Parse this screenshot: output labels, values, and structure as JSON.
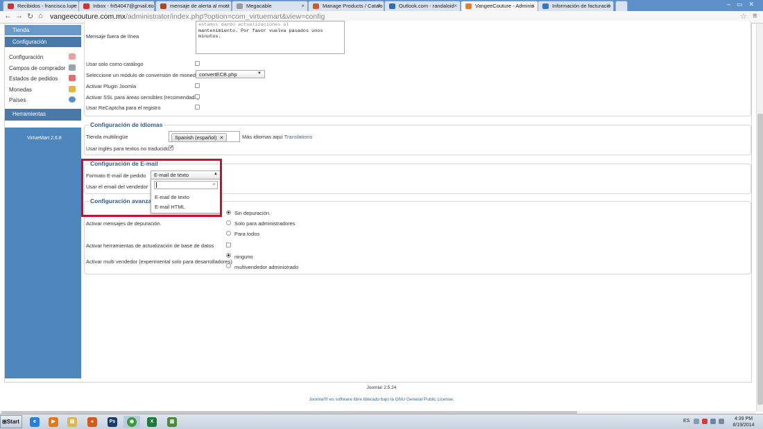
{
  "browser": {
    "tabs": [
      {
        "label": "Recibidos - francisco.lupe",
        "color": "#c33"
      },
      {
        "label": "Inbox - fri54047@gmail.co",
        "color": "#c33"
      },
      {
        "label": "mensaje de alerta al most",
        "color": "#b5431a"
      },
      {
        "label": "Megacable",
        "color": "#999"
      },
      {
        "label": "Manage Products / Catalo",
        "color": "#d05a2a"
      },
      {
        "label": "Outlook.com - randaloid",
        "color": "#2a6fb8"
      },
      {
        "label": "VangeeCouture - Adminis",
        "color": "#e0822a"
      },
      {
        "label": "Información de facturació",
        "color": "#3a75c4"
      }
    ],
    "url_host": "vangeecouture.com.mx",
    "url_path": "/administrator/index.php?option=com_virtuemart&view=config"
  },
  "sidebar": {
    "tienda": "Tienda",
    "configuracion_header": "Configuración",
    "items": [
      {
        "label": "Configuración",
        "icon": "wrench-icon",
        "color": "#e8a0a0"
      },
      {
        "label": "Campos de comprador",
        "icon": "fields-icon",
        "color": "#9aa4b0"
      },
      {
        "label": "Estados de pedidos",
        "icon": "order-status-icon",
        "color": "#e07070"
      },
      {
        "label": "Monedas",
        "icon": "coins-icon",
        "color": "#e6b24a"
      },
      {
        "label": "Países",
        "icon": "globe-icon",
        "color": "#5a8fc8"
      }
    ],
    "herramientas": "Herramientas",
    "version": "VirtueMart 2.6.8"
  },
  "general": {
    "mensaje_label": "Mensaje fuera de línea",
    "mensaje_text_lines": [
      "estamos dando actualizaciones al",
      "mantenimiento. Por favor vuelva pasados unos",
      "minutos."
    ],
    "catalog_label": "Usar solo como catálogo",
    "currency_label": "Seleccione un módulo de conversión de moneda",
    "currency_value": "convertECB.php",
    "joomla_plugin_label": "Activar Plugin Joomla",
    "ssl_label": "Activar SSL para áreas sensibles (recomendado)",
    "recaptcha_label": "Usar ReCaptcha para el registro"
  },
  "idiomas": {
    "legend": "Configuración de idiomas",
    "multi_label": "Tienda multilingüe",
    "chip": "Spanish (español)",
    "more_text": "Más idiomas aquí",
    "more_link": "Translations",
    "english_label": "Usar inglés para textos no traducidos"
  },
  "email": {
    "legend": "Configuración de E-mail",
    "format_label": "Formato E-mail de pedido",
    "format_value": "E-mail de texto",
    "vendor_label": "Usar el email del vendedor",
    "options": [
      "E-mail de texto",
      "E-mail HTML"
    ]
  },
  "avanzada": {
    "legend": "Configuración avanzada",
    "debug_label": "Activar mensajes de depuración.",
    "debug_options": [
      "Sin depuración.",
      "Solo para administradores",
      "Para todos"
    ],
    "db_tools_label": "Activar herramientas de actualización de base de datos",
    "multivendor_label": "Activar multi vendedor (experimental solo para desarrolladores)",
    "multivendor_options": [
      "ninguno",
      "multivendedor administrado"
    ]
  },
  "footer": {
    "version": "Joomla! 2.5.24",
    "license_prefix": "Joomla!® es software libre liberado bajo la",
    "license_link": "GNU General Public License",
    "license_suffix": "."
  },
  "taskbar": {
    "start": "Start",
    "lang": "ES",
    "time": "4:39 PM",
    "date": "8/19/2014",
    "apps": [
      {
        "name": "ie-icon",
        "color": "#2a7fd4",
        "glyph": "e"
      },
      {
        "name": "media-player-icon",
        "color": "#e07a1a",
        "glyph": "▶"
      },
      {
        "name": "explorer-icon",
        "color": "#e0c060",
        "glyph": "▤"
      },
      {
        "name": "firefox-icon",
        "color": "#d45a1a",
        "glyph": "●"
      },
      {
        "name": "photoshop-icon",
        "color": "#1a3a6a",
        "glyph": "Ps"
      },
      {
        "name": "chrome-icon",
        "color": "#3a9a3a",
        "glyph": "◉"
      },
      {
        "name": "excel-icon",
        "color": "#1e7a3a",
        "glyph": "X"
      },
      {
        "name": "chart-app-icon",
        "color": "#4a8a3a",
        "glyph": "▥"
      }
    ]
  }
}
